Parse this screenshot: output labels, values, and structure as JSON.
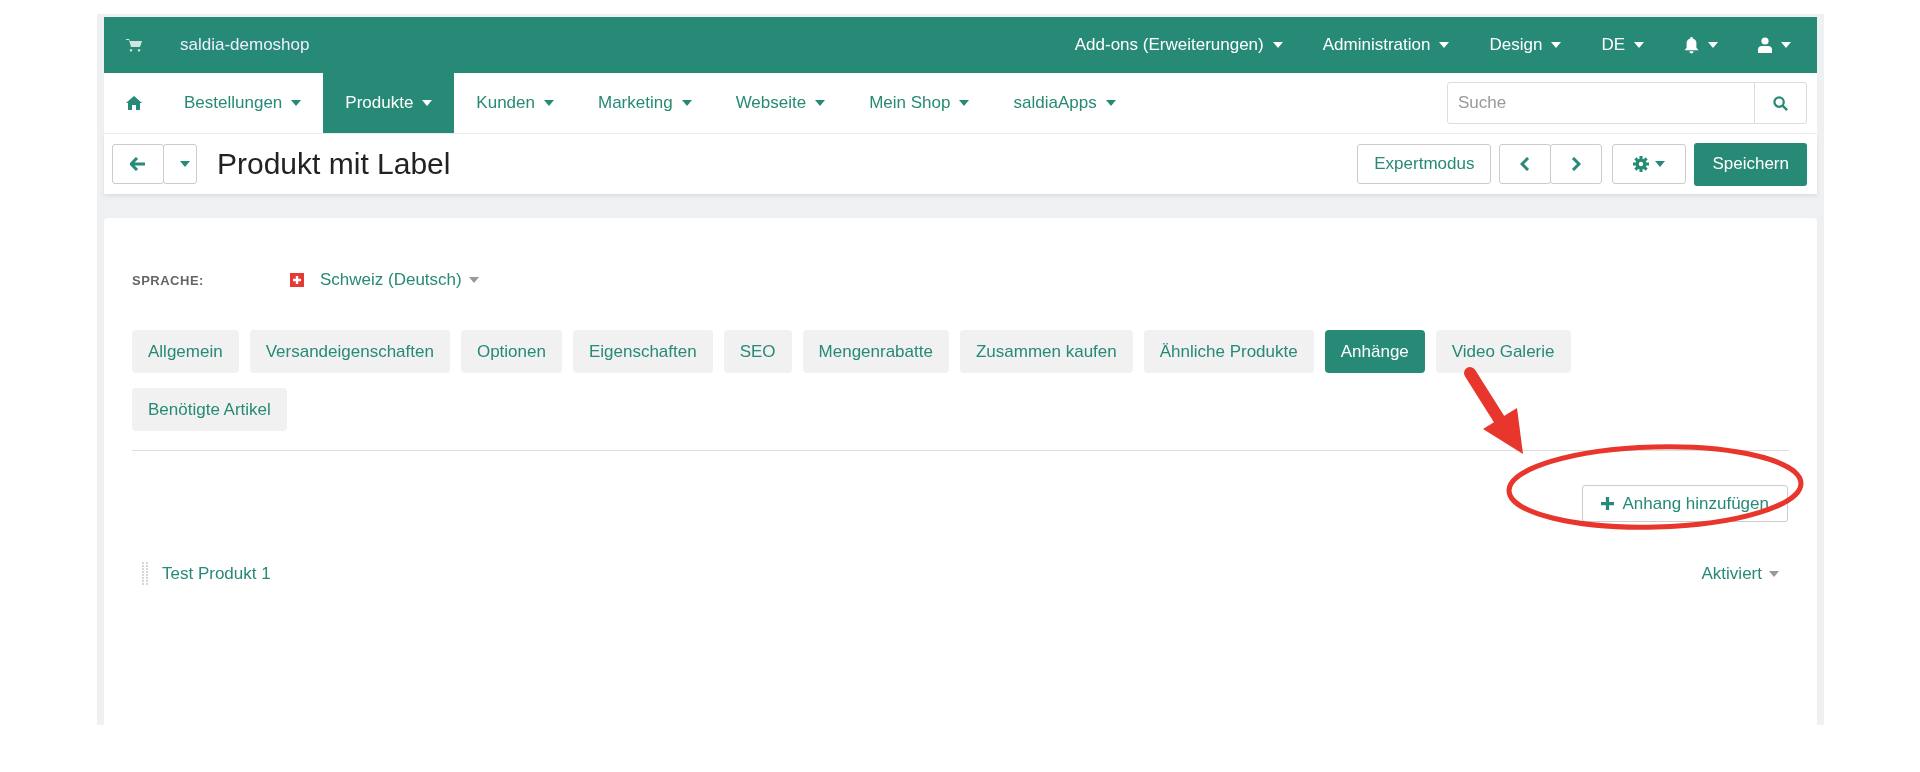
{
  "topbar": {
    "shop_name": "saldia-demoshop",
    "menus": [
      {
        "label": "Add-ons (Erweiterungen)",
        "kind": "text"
      },
      {
        "label": "Administration",
        "kind": "text"
      },
      {
        "label": "Design",
        "kind": "text"
      },
      {
        "label": "DE",
        "kind": "text"
      },
      {
        "kind": "bell"
      },
      {
        "kind": "user"
      }
    ]
  },
  "nav": {
    "items": [
      {
        "label": "Bestellungen",
        "selected": false
      },
      {
        "label": "Produkte",
        "selected": true
      },
      {
        "label": "Kunden",
        "selected": false
      },
      {
        "label": "Marketing",
        "selected": false
      },
      {
        "label": "Webseite",
        "selected": false
      },
      {
        "label": "Mein Shop",
        "selected": false
      },
      {
        "label": "saldiaApps",
        "selected": false
      }
    ],
    "search": {
      "placeholder": "Suche"
    }
  },
  "toolbar": {
    "title": "Produkt mit Label",
    "expert_button": "Expertmodus",
    "save_button": "Speichern"
  },
  "language": {
    "label": "SPRACHE:",
    "value": "Schweiz (Deutsch)"
  },
  "tabs": [
    {
      "label": "Allgemein",
      "selected": false
    },
    {
      "label": "Versandeigenschaften",
      "selected": false
    },
    {
      "label": "Optionen",
      "selected": false
    },
    {
      "label": "Eigenschaften",
      "selected": false
    },
    {
      "label": "SEO",
      "selected": false
    },
    {
      "label": "Mengenrabatte",
      "selected": false
    },
    {
      "label": "Zusammen kaufen",
      "selected": false
    },
    {
      "label": "Ähnliche Produkte",
      "selected": false
    },
    {
      "label": "Anhänge",
      "selected": true
    },
    {
      "label": "Video Galerie",
      "selected": false
    },
    {
      "label": "Benötigte Artikel",
      "selected": false
    }
  ],
  "add_button": "Anhang hinzufügen",
  "attachments": [
    {
      "name": "Test Produkt 1",
      "status": "Aktiviert"
    }
  ]
}
